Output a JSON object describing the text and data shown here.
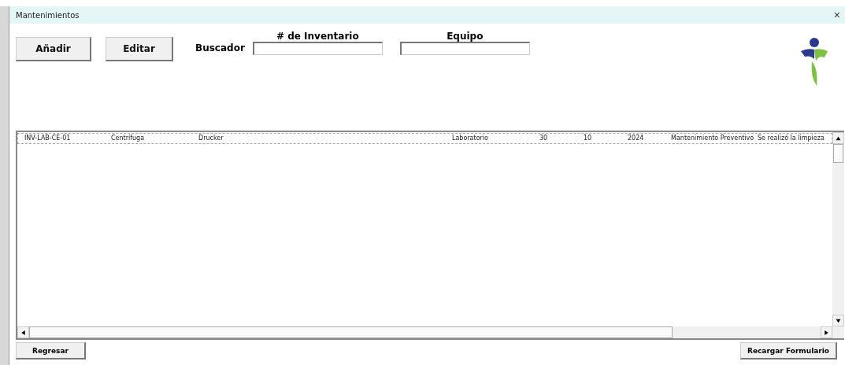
{
  "window": {
    "title": "Mantenimientos",
    "close": "×"
  },
  "toolbar": {
    "buttons": [
      "Añadir",
      "Editar"
    ],
    "search_label": "Buscador",
    "fields": [
      {
        "label": "# de Inventario"
      },
      {
        "label": "Equipo"
      }
    ]
  },
  "list": {
    "rows": [
      {
        "selected": false,
        "cells": [
          "INV-LAB-CE-01",
          "Centrífuga",
          "Drucker",
          "Laboratorio",
          "30",
          "10",
          "2024",
          "Mantenimiento Preventivo",
          "Se realizó la limpieza"
        ]
      }
    ]
  },
  "footer": {
    "buttons": [
      "Regresar",
      "Recargar Formulario"
    ]
  }
}
